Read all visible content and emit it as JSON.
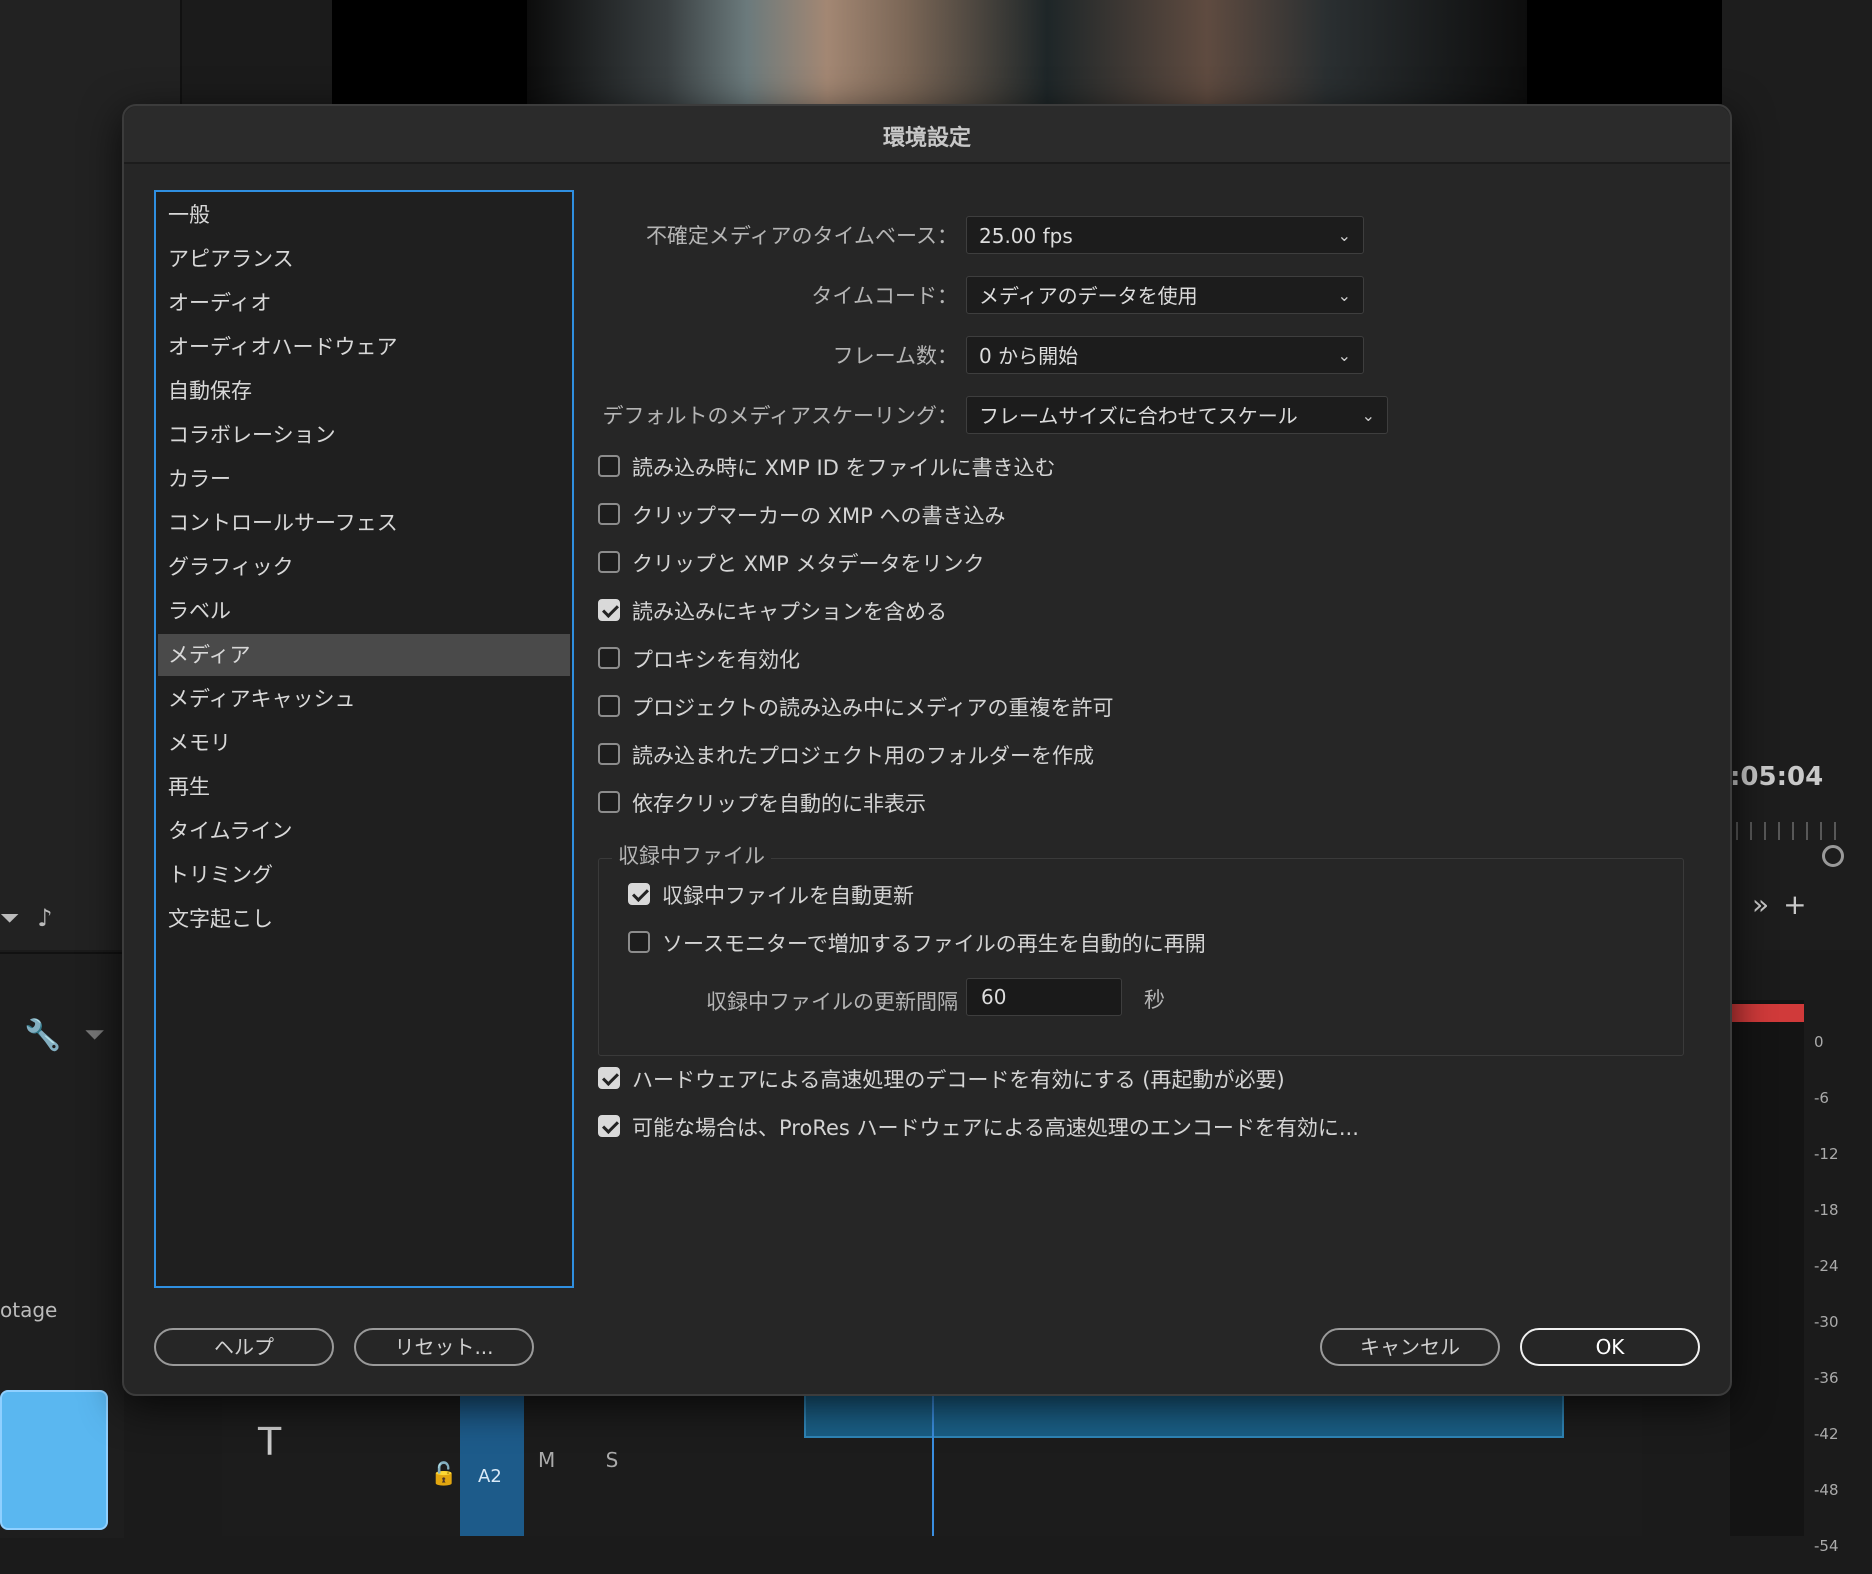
{
  "dialog": {
    "title": "環境設定",
    "categories": [
      "一般",
      "アピアランス",
      "オーディオ",
      "オーディオハードウェア",
      "自動保存",
      "コラボレーション",
      "カラー",
      "コントロールサーフェス",
      "グラフィック",
      "ラベル",
      "メディア",
      "メディアキャッシュ",
      "メモリ",
      "再生",
      "タイムライン",
      "トリミング",
      "文字起こし"
    ],
    "selected_category": "メディア",
    "settings": {
      "timebase_label": "不確定メディアのタイムベース：",
      "timebase_value": "25.00 fps",
      "timecode_label": "タイムコード：",
      "timecode_value": "メディアのデータを使用",
      "frame_label": "フレーム数：",
      "frame_value": "0 から開始",
      "scaling_label": "デフォルトのメディアスケーリング：",
      "scaling_value": "フレームサイズに合わせてスケール"
    },
    "checkboxes": [
      {
        "label": "読み込み時に XMP ID をファイルに書き込む",
        "checked": false
      },
      {
        "label": "クリップマーカーの XMP への書き込み",
        "checked": false
      },
      {
        "label": "クリップと XMP メタデータをリンク",
        "checked": false
      },
      {
        "label": "読み込みにキャプションを含める",
        "checked": true
      },
      {
        "label": "プロキシを有効化",
        "checked": false
      },
      {
        "label": "プロジェクトの読み込み中にメディアの重複を許可",
        "checked": false
      },
      {
        "label": "読み込まれたプロジェクト用のフォルダーを作成",
        "checked": false
      },
      {
        "label": "依存クリップを自動的に非表示",
        "checked": false
      }
    ],
    "growing_files": {
      "title": "収録中ファイル",
      "auto_refresh": {
        "label": "収録中ファイルを自動更新",
        "checked": true
      },
      "resume_playback": {
        "label": "ソースモニターで増加するファイルの再生を自動的に再開",
        "checked": false
      },
      "interval_label": "収録中ファイルの更新間隔",
      "interval_value": "60",
      "interval_unit": "秒"
    },
    "hardware": [
      {
        "label": "ハードウェアによる高速処理のデコードを有効にする (再起動が必要)",
        "checked": true
      },
      {
        "label": "可能な場合は、ProRes ハードウェアによる高速処理のエンコードを有効に...",
        "checked": true
      }
    ],
    "buttons": {
      "help": "ヘルプ",
      "reset": "リセット...",
      "cancel": "キャンセル",
      "ok": "OK"
    }
  },
  "background": {
    "timecode": ":05:04",
    "footage_label": "otage",
    "track_label": "A2",
    "track_buttons": "M S",
    "meter_scale": [
      "0",
      "-6",
      "-12",
      "-18",
      "-24",
      "-30",
      "-36",
      "-42",
      "-48",
      "-54"
    ]
  }
}
